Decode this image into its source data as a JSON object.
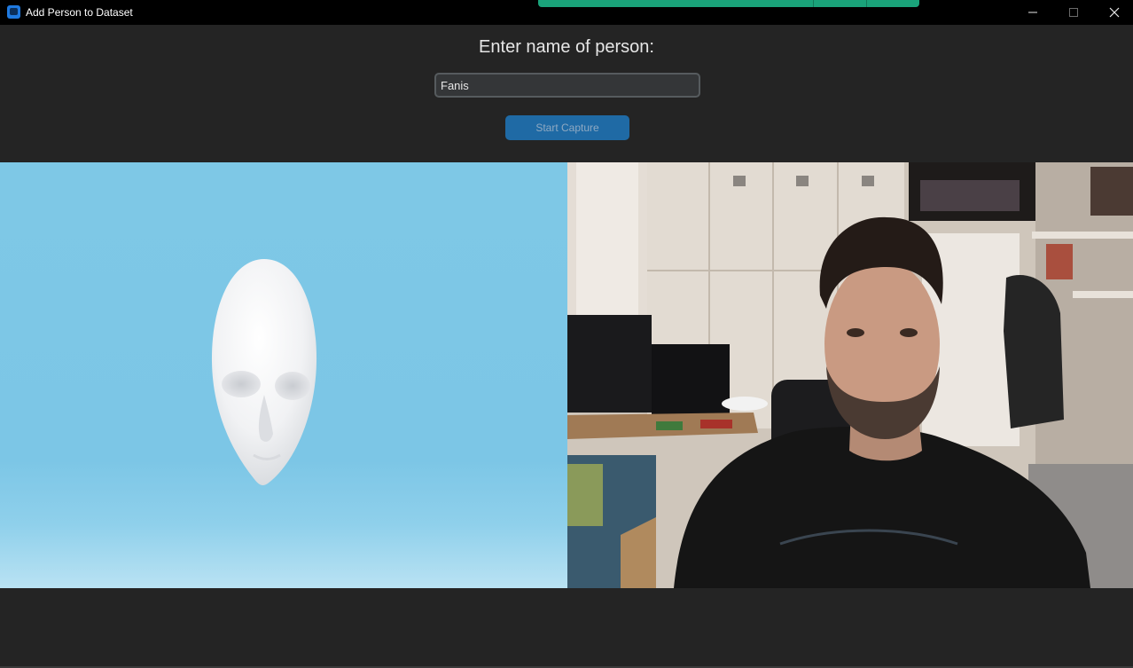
{
  "window": {
    "title": "Add Person to Dataset",
    "icon": "app-window-icon",
    "controls": [
      "minimize-icon",
      "maximize-icon",
      "close-icon"
    ]
  },
  "form": {
    "prompt": "Enter name of person:",
    "name_value": "Fanis",
    "start_button_label": "Start Capture"
  },
  "panels": {
    "left": {
      "content": "3d-face-mask-render",
      "background": "#7ec8e6"
    },
    "right": {
      "content": "webcam-feed"
    }
  },
  "colors": {
    "accent": "#1f6aa5",
    "window_bg": "#242424",
    "titlebar_bg": "#000000",
    "overlay_strip": "#1aa37a"
  }
}
